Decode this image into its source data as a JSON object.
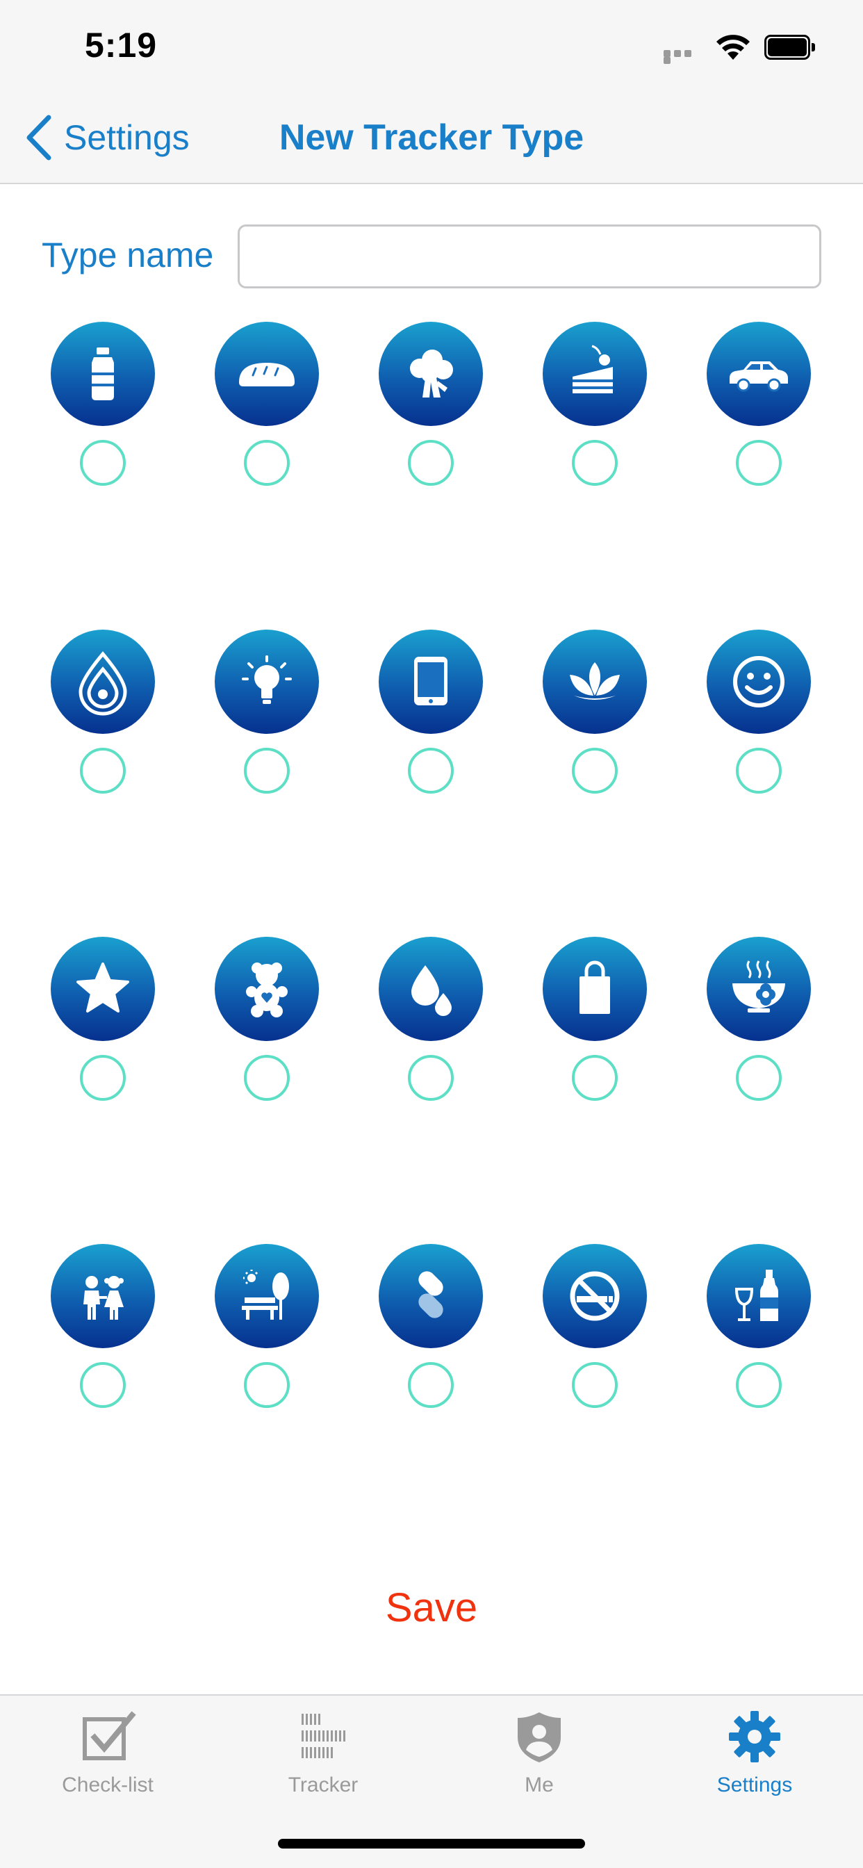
{
  "status_bar": {
    "time": "5:19"
  },
  "nav": {
    "back_label": "Settings",
    "title": "New Tracker Type"
  },
  "form": {
    "type_name_label": "Type name",
    "type_name_value": "",
    "type_name_placeholder": ""
  },
  "icon_rows": [
    [
      {
        "icon": "water-bottle-icon",
        "selected": false
      },
      {
        "icon": "bread-icon",
        "selected": false
      },
      {
        "icon": "broccoli-icon",
        "selected": false
      },
      {
        "icon": "cake-icon",
        "selected": false
      },
      {
        "icon": "car-icon",
        "selected": false
      }
    ],
    [
      {
        "icon": "water-drop-ripple-icon",
        "selected": false
      },
      {
        "icon": "lightbulb-icon",
        "selected": false
      },
      {
        "icon": "tablet-icon",
        "selected": false
      },
      {
        "icon": "lotus-icon",
        "selected": false
      },
      {
        "icon": "smiley-icon",
        "selected": false
      }
    ],
    [
      {
        "icon": "star-icon",
        "selected": false
      },
      {
        "icon": "teddy-bear-icon",
        "selected": false
      },
      {
        "icon": "drops-icon",
        "selected": false
      },
      {
        "icon": "shopping-bag-icon",
        "selected": false
      },
      {
        "icon": "hot-food-bowl-icon",
        "selected": false
      }
    ],
    [
      {
        "icon": "children-icon",
        "selected": false
      },
      {
        "icon": "park-bench-icon",
        "selected": false
      },
      {
        "icon": "pill-capsule-icon",
        "selected": false
      },
      {
        "icon": "no-smoking-icon",
        "selected": false
      },
      {
        "icon": "wine-bottle-glass-icon",
        "selected": false
      }
    ]
  ],
  "actions": {
    "save_label": "Save"
  },
  "tabs": [
    {
      "label": "Check-list",
      "icon": "checkbox-icon",
      "active": false
    },
    {
      "label": "Tracker",
      "icon": "barcode-icon",
      "active": false
    },
    {
      "label": "Me",
      "icon": "shield-user-icon",
      "active": false
    },
    {
      "label": "Settings",
      "icon": "gear-icon",
      "active": true
    }
  ],
  "colors": {
    "accent": "#1a7fc9",
    "save": "#f0330e",
    "radio": "#5ddfc6",
    "bubble_top": "#1aa0cf",
    "bubble_bottom": "#06318f",
    "inactive_tab": "#9a9a9a"
  }
}
